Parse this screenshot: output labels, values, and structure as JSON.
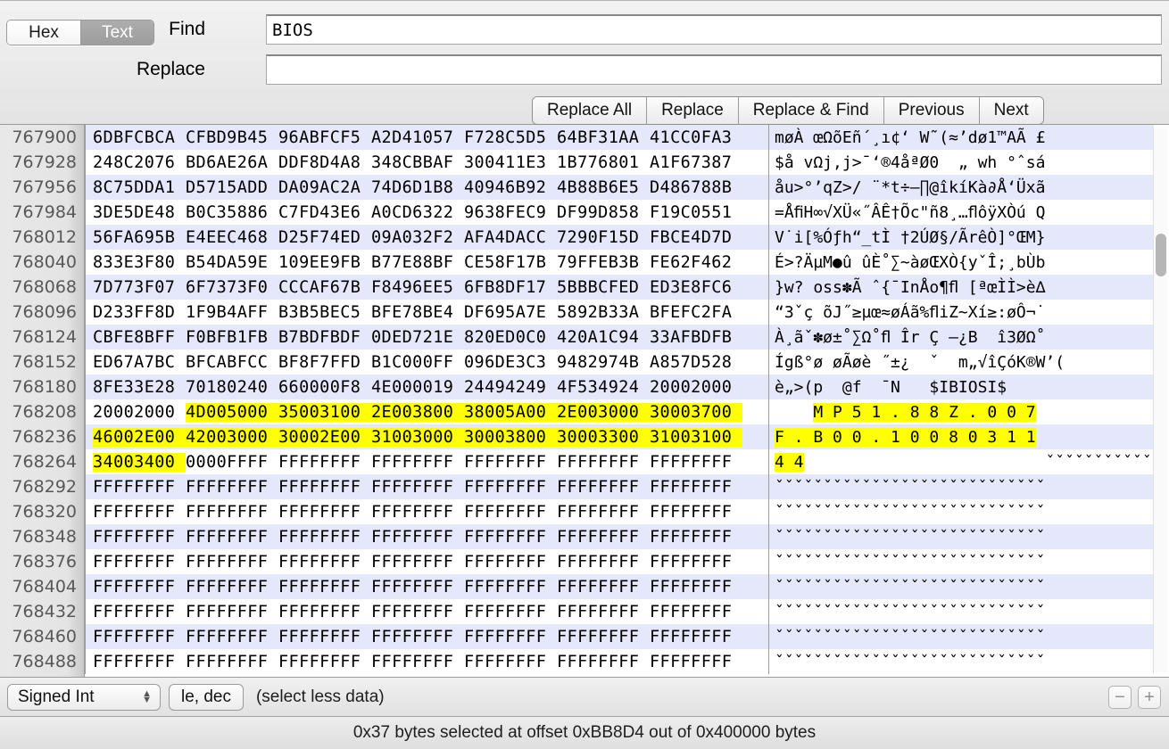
{
  "findbar": {
    "mode_toggle": {
      "options": [
        "Hex",
        "Text"
      ],
      "selected": "Text"
    },
    "find_label": "Find",
    "find_value": "BIOS",
    "find_placeholder": "",
    "replace_label": "Replace",
    "replace_value": "",
    "replace_placeholder": "",
    "buttons": [
      "Replace All",
      "Replace",
      "Replace & Find",
      "Previous",
      "Next"
    ]
  },
  "inspector": {
    "type_popup": "Signed Int",
    "endian_button": "le, dec",
    "hint": "(select less data)",
    "minus_label": "−",
    "plus_label": "+"
  },
  "status": {
    "text": "0x37 bytes selected at offset 0xBB8D4 out of 0x400000 bytes"
  },
  "colors": {
    "selection_highlight": "#ffff00",
    "row_alt": "#e4e8fa",
    "row_base": "#ffffff",
    "toolbar": "#e3e3e3"
  },
  "hex_view": {
    "bytes_per_row": 28,
    "group_size": 4,
    "groups_per_row": 7,
    "rows": [
      {
        "offset": "767900",
        "hex": [
          "6DBFCBCA",
          "CFBD9B45",
          "96ABFCF5",
          "A2D41057",
          "F728C5D5",
          "64BF31AA",
          "41CC0FA3"
        ],
        "ascii": "møÀ œΩõEñ´¸ı¢‘ W˜(≈’dø1™AÃ £",
        "hl_start": null,
        "hl_end": null
      },
      {
        "offset": "767928",
        "hex": [
          "248C2076",
          "BD6AE26A",
          "DDF8D4A8",
          "348CBBAF",
          "300411E3",
          "1B776801",
          "A1F67387"
        ],
        "ascii": "$å vΩj,j>¯‘®4åªØ0  „ wh °ˆsá",
        "hl_start": null,
        "hl_end": null
      },
      {
        "offset": "767956",
        "hex": [
          "8C75DDA1",
          "D5715ADD",
          "DA09AC2A",
          "74D6D1B8",
          "40946B92",
          "4B88B6E5",
          "D486788B"
        ],
        "ascii": "åu>°’qZ>/ ¨*t÷–∏@îkíKà∂Å‘Üxã",
        "hl_start": null,
        "hl_end": null
      },
      {
        "offset": "767984",
        "hex": [
          "3DE5DE48",
          "B0C35886",
          "C7FD43E6",
          "A0CD6322",
          "9638FEC9",
          "DF99D858",
          "F19C0551"
        ],
        "ascii": "=ÅﬁH∞√XÜ«˝ÂÊ†Õc\"ñ8¸…ﬂôÿXÒú Q",
        "hl_start": null,
        "hl_end": null
      },
      {
        "offset": "768012",
        "hex": [
          "56FA695B",
          "E4EEC468",
          "D25F74ED",
          "09A032F2",
          "AFA4DACC",
          "7290F15D",
          "FBCE4D7D"
        ],
        "ascii": "V˙i[%Óƒh“_tÌ †2ÚØ§/ÃrêÒ]°ŒM}",
        "hl_start": null,
        "hl_end": null
      },
      {
        "offset": "768040",
        "hex": [
          "833E3F80",
          "B54DA59E",
          "109EE9FB",
          "B77E88BF",
          "CE58F17B",
          "79FFEB3B",
          "FE62F462"
        ],
        "ascii": "É>?ÄµM●û ûÈ˚∑~àøŒXÒ{yˇÎ;¸bÙb",
        "hl_start": null,
        "hl_end": null
      },
      {
        "offset": "768068",
        "hex": [
          "7D773F07",
          "6F7373F0",
          "CCCAF67B",
          "F8496EE5",
          "6FB8DF17",
          "5BBBCFED",
          "ED3E8FC6"
        ],
        "ascii": "}w? oss✽Ã ˆ{¯InÅo¶ﬂ [ªœÌÌ>è∆",
        "hl_start": null,
        "hl_end": null
      },
      {
        "offset": "768096",
        "hex": [
          "D233FF8D",
          "1F9B4AFF",
          "B3B5BEC5",
          "BFE78BE4",
          "DF695A7E",
          "5892B33A",
          "BFEFC2FA"
        ],
        "ascii": "“3ˇç õJ˝≥µœ≈øÁã%ﬂiZ~Xí≥:øÔ¬˙",
        "hl_start": null,
        "hl_end": null
      },
      {
        "offset": "768124",
        "hex": [
          "CBFE8BFF",
          "F0BFB1FB",
          "B7BDFBDF",
          "0DED721E",
          "820ED0C0",
          "420A1C94",
          "33AFBDFB"
        ],
        "ascii": "À¸ãˇ✽ø±˚∑Ω˚ﬂ Îr Ç –¿B  î3ØΩ˚",
        "hl_start": null,
        "hl_end": null
      },
      {
        "offset": "768152",
        "hex": [
          "ED67A7BC",
          "BFCABFCC",
          "BF8F7FFD",
          "B1C000FF",
          "096DE3C3",
          "9482974B",
          "A857D528"
        ],
        "ascii": "Ígß°ø øÃøè ˝±¿  ˇ  m„√îÇóK®W’(",
        "hl_start": null,
        "hl_end": null
      },
      {
        "offset": "768180",
        "hex": [
          "8FE33E28",
          "70180240",
          "660000F8",
          "4E000019",
          "24494249",
          "4F534924",
          "20002000"
        ],
        "ascii": "è„>(p  @f  ¯N   $IBIOSI$",
        "hl_start": null,
        "hl_end": null
      },
      {
        "offset": "768208",
        "hex": [
          "20002000",
          "4D005000",
          "35003100",
          "2E003800",
          "38005A00",
          "2E003000",
          "30003700"
        ],
        "ascii": "    M P 5 1 . 8 8 Z . 0 0 7",
        "hl_start": 1,
        "hl_end": 7,
        "ascii_hl_start": 4,
        "ascii_hl_end": 27
      },
      {
        "offset": "768236",
        "hex": [
          "46002E00",
          "42003000",
          "30002E00",
          "31003000",
          "30003800",
          "30003300",
          "31003100"
        ],
        "ascii": "F . B 0 0 . 1 0 0 8 0 3 1 1",
        "hl_start": 0,
        "hl_end": 7,
        "ascii_hl_start": 0,
        "ascii_hl_end": 27
      },
      {
        "offset": "768264",
        "hex": [
          "34003400",
          "0000FFFF",
          "FFFFFFFF",
          "FFFFFFFF",
          "FFFFFFFF",
          "FFFFFFFF",
          "FFFFFFFF"
        ],
        "ascii": "4 4                         ",
        "hl_start": 0,
        "hl_end": 1,
        "ascii_hl_start": 0,
        "ascii_hl_end": 3,
        "ascii_tail_dots": 24
      },
      {
        "offset": "768292",
        "hex": [
          "FFFFFFFF",
          "FFFFFFFF",
          "FFFFFFFF",
          "FFFFFFFF",
          "FFFFFFFF",
          "FFFFFFFF",
          "FFFFFFFF"
        ],
        "ascii": "ˇˇˇˇˇˇˇˇˇˇˇˇˇˇˇˇˇˇˇˇˇˇˇˇˇˇˇˇ",
        "hl_start": null,
        "hl_end": null
      },
      {
        "offset": "768320",
        "hex": [
          "FFFFFFFF",
          "FFFFFFFF",
          "FFFFFFFF",
          "FFFFFFFF",
          "FFFFFFFF",
          "FFFFFFFF",
          "FFFFFFFF"
        ],
        "ascii": "ˇˇˇˇˇˇˇˇˇˇˇˇˇˇˇˇˇˇˇˇˇˇˇˇˇˇˇˇ",
        "hl_start": null,
        "hl_end": null
      },
      {
        "offset": "768348",
        "hex": [
          "FFFFFFFF",
          "FFFFFFFF",
          "FFFFFFFF",
          "FFFFFFFF",
          "FFFFFFFF",
          "FFFFFFFF",
          "FFFFFFFF"
        ],
        "ascii": "ˇˇˇˇˇˇˇˇˇˇˇˇˇˇˇˇˇˇˇˇˇˇˇˇˇˇˇˇ",
        "hl_start": null,
        "hl_end": null
      },
      {
        "offset": "768376",
        "hex": [
          "FFFFFFFF",
          "FFFFFFFF",
          "FFFFFFFF",
          "FFFFFFFF",
          "FFFFFFFF",
          "FFFFFFFF",
          "FFFFFFFF"
        ],
        "ascii": "ˇˇˇˇˇˇˇˇˇˇˇˇˇˇˇˇˇˇˇˇˇˇˇˇˇˇˇˇ",
        "hl_start": null,
        "hl_end": null
      },
      {
        "offset": "768404",
        "hex": [
          "FFFFFFFF",
          "FFFFFFFF",
          "FFFFFFFF",
          "FFFFFFFF",
          "FFFFFFFF",
          "FFFFFFFF",
          "FFFFFFFF"
        ],
        "ascii": "ˇˇˇˇˇˇˇˇˇˇˇˇˇˇˇˇˇˇˇˇˇˇˇˇˇˇˇˇ",
        "hl_start": null,
        "hl_end": null
      },
      {
        "offset": "768432",
        "hex": [
          "FFFFFFFF",
          "FFFFFFFF",
          "FFFFFFFF",
          "FFFFFFFF",
          "FFFFFFFF",
          "FFFFFFFF",
          "FFFFFFFF"
        ],
        "ascii": "ˇˇˇˇˇˇˇˇˇˇˇˇˇˇˇˇˇˇˇˇˇˇˇˇˇˇˇˇ",
        "hl_start": null,
        "hl_end": null
      },
      {
        "offset": "768460",
        "hex": [
          "FFFFFFFF",
          "FFFFFFFF",
          "FFFFFFFF",
          "FFFFFFFF",
          "FFFFFFFF",
          "FFFFFFFF",
          "FFFFFFFF"
        ],
        "ascii": "ˇˇˇˇˇˇˇˇˇˇˇˇˇˇˇˇˇˇˇˇˇˇˇˇˇˇˇˇ",
        "hl_start": null,
        "hl_end": null
      },
      {
        "offset": "768488",
        "hex": [
          "FFFFFFFF",
          "FFFFFFFF",
          "FFFFFFFF",
          "FFFFFFFF",
          "FFFFFFFF",
          "FFFFFFFF",
          "FFFFFFFF"
        ],
        "ascii": "ˇˇˇˇˇˇˇˇˇˇˇˇˇˇˇˇˇˇˇˇˇˇˇˇˇˇˇˇ",
        "hl_start": null,
        "hl_end": null
      }
    ]
  }
}
